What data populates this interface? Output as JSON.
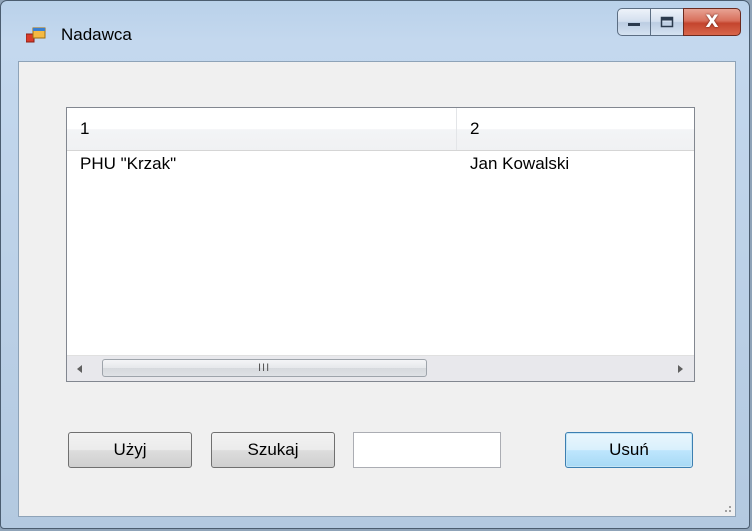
{
  "window": {
    "title": "Nadawca",
    "icon": "form-app-icon"
  },
  "caption": {
    "minimize_icon": "minimize-icon",
    "maximize_icon": "maximize-icon",
    "close_icon": "close-icon",
    "close_glyph": "X"
  },
  "listview": {
    "columns": [
      "1",
      "2"
    ],
    "rows": [
      [
        "PHU \"Krzak\"",
        "Jan Kowalski"
      ]
    ],
    "scrollbar_grip": "III"
  },
  "buttons": {
    "use_label": "Użyj",
    "search_label": "Szukaj",
    "delete_label": "Usuń"
  },
  "search": {
    "value": ""
  }
}
